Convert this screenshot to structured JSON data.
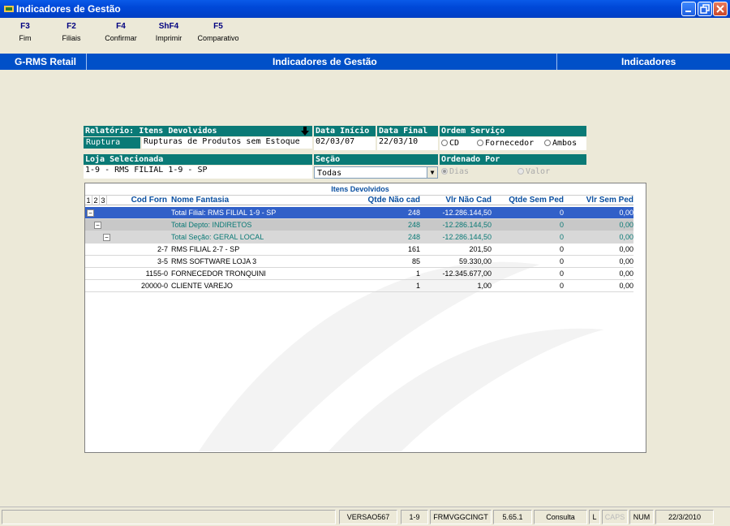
{
  "window": {
    "title": "Indicadores de Gestão"
  },
  "toolbar": [
    {
      "key": "F3",
      "label": "Fim"
    },
    {
      "key": "F2",
      "label": "Filiais"
    },
    {
      "key": "F4",
      "label": "Confirmar"
    },
    {
      "key": "ShF4",
      "label": "Imprimir"
    },
    {
      "key": "F5",
      "label": "Comparativo"
    }
  ],
  "band": {
    "left": "G-RMS Retail",
    "center": "Indicadores de Gestão",
    "right": "Indicadores"
  },
  "filters": {
    "relatorio_label": "Relatório: Itens Devolvidos",
    "relatorio_code": "Ruptura",
    "relatorio_desc": "Rupturas de Produtos sem Estoque",
    "data_inicio_label": "Data Início",
    "data_inicio": "02/03/07",
    "data_final_label": "Data Final",
    "data_final": "22/03/10",
    "ordem_label": "Ordem Serviço",
    "ordem_options": [
      "CD",
      "Fornecedor",
      "Ambos"
    ],
    "loja_label": "Loja Selecionada",
    "loja_value": "1-9 - RMS FILIAL 1-9 - SP",
    "secao_label": "Seção",
    "secao_value": "Todas",
    "ordenado_label": "Ordenado Por",
    "ordenado_options": [
      "Dias",
      "Valor"
    ]
  },
  "grid": {
    "title": "Itens Devolvidos",
    "levels": [
      "1",
      "2",
      "3"
    ],
    "columns": [
      "Cod Forn",
      "Nome Fantasia",
      "Qtde Não cad",
      "Vlr Não Cad",
      "Qtde Sem Ped",
      "Vlr Sem Ped"
    ],
    "rows": [
      {
        "cod": "",
        "nome": "Total Filial: RMS FILIAL 1-9 - SP",
        "qtde_nao": "248",
        "vlr_nao": "-12.286.144,50",
        "qtde_sem": "0",
        "vlr_sem": "0,00"
      },
      {
        "cod": "",
        "nome": "Total Depto: INDIRETOS",
        "qtde_nao": "248",
        "vlr_nao": "-12.286.144,50",
        "qtde_sem": "0",
        "vlr_sem": "0,00"
      },
      {
        "cod": "",
        "nome": "Total Seção: GERAL LOCAL",
        "qtde_nao": "248",
        "vlr_nao": "-12.286.144,50",
        "qtde_sem": "0",
        "vlr_sem": "0,00"
      },
      {
        "cod": "2-7",
        "nome": "RMS FILIAL 2-7 - SP",
        "qtde_nao": "161",
        "vlr_nao": "201,50",
        "qtde_sem": "0",
        "vlr_sem": "0,00"
      },
      {
        "cod": "3-5",
        "nome": "RMS SOFTWARE LOJA 3",
        "qtde_nao": "85",
        "vlr_nao": "59.330,00",
        "qtde_sem": "0",
        "vlr_sem": "0,00"
      },
      {
        "cod": "1155-0",
        "nome": "FORNECEDOR TRONQUINI",
        "qtde_nao": "1",
        "vlr_nao": "-12.345.677,00",
        "qtde_sem": "0",
        "vlr_sem": "0,00"
      },
      {
        "cod": "20000-0",
        "nome": "CLIENTE VAREJO",
        "qtde_nao": "1",
        "vlr_nao": "1,00",
        "qtde_sem": "0",
        "vlr_sem": "0,00"
      }
    ]
  },
  "status": {
    "version": "VERSAO567",
    "filial": "1-9",
    "form": "FRMVGGCINGT",
    "build": "5.65.1",
    "mode": "Consulta",
    "l": "L",
    "caps": "CAPS",
    "num": "NUM",
    "date": "22/3/2010"
  }
}
